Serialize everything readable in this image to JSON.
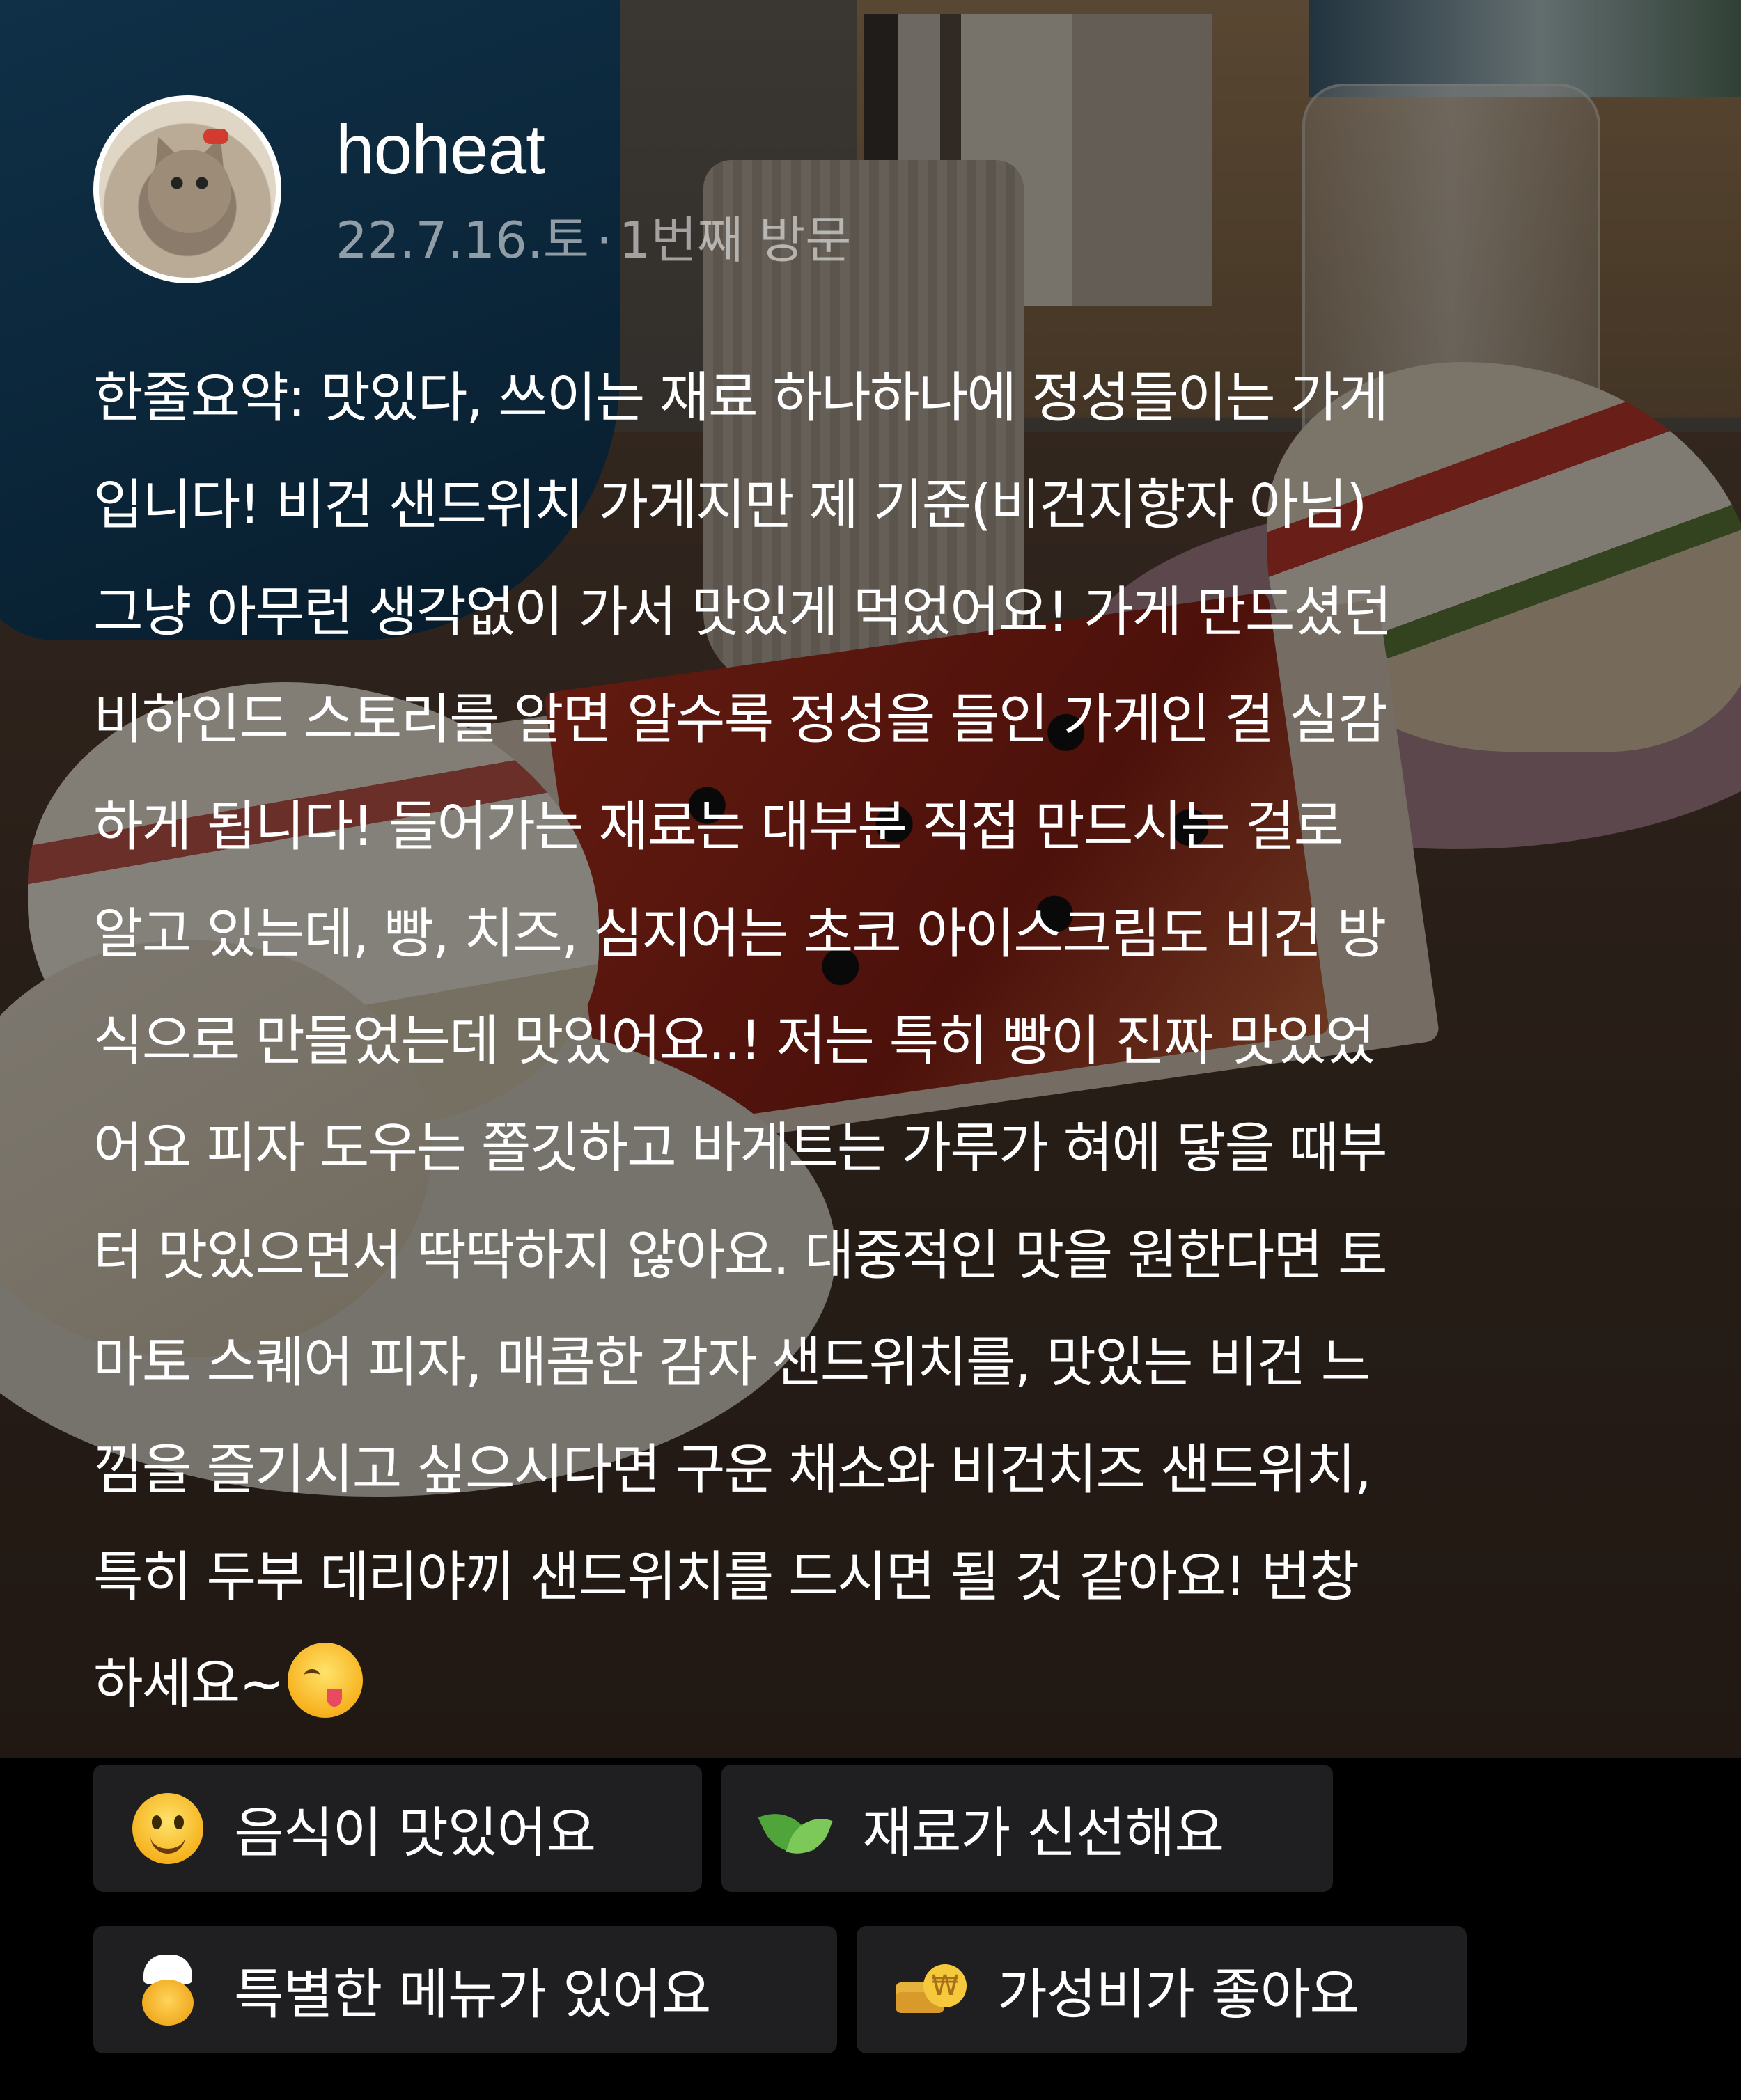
{
  "review": {
    "username": "hoheat",
    "date": "22.7.16.토",
    "separator": "·",
    "visit": "1번째 방문",
    "body_lines": [
      "한줄요약: 맛있다, 쓰이는 재료 하나하나에 정성들이는 가게",
      "입니다! 비건 샌드위치 가게지만 제 기준(비건지향자 아님)",
      "그냥 아무런 생각없이 가서 맛있게 먹었어요! 가게 만드셨던",
      "비하인드 스토리를 알면 알수록 정성을 들인 가게인 걸 실감",
      "하게 됩니다! 들어가는 재료는 대부분 직접 만드시는 걸로",
      "알고 있는데, 빵, 치즈, 심지어는 초코 아이스크림도 비건 방",
      "식으로 만들었는데 맛있어요..! 저는 특히 빵이 진짜 맛있었",
      "어요 피자 도우는 쫄깃하고 바게트는 가루가 혀에 닿을 때부",
      "터 맛있으면서 딱딱하지 않아요. 대중적인 맛을 원한다면 토",
      "마토 스퀘어 피자, 매콤한 감자 샌드위치를, 맛있는 비건 느",
      "낌을 즐기시고 싶으시다면 구운 채소와 비건치즈 샌드위치,",
      "특히 두부 데리야끼 샌드위치를 드시면 될 것 같아요! 번창",
      "하세요~"
    ],
    "end_emoji": "yum-face-emoji"
  },
  "keywords": [
    {
      "label": "음식이 맛있어요",
      "icon": "smiling-face-icon"
    },
    {
      "label": "재료가 신선해요",
      "icon": "leaf-icon"
    },
    {
      "label": "특별한 메뉴가 있어요",
      "icon": "chef-icon"
    },
    {
      "label": "가성비가 좋아요",
      "icon": "coin-icon"
    }
  ],
  "colors": {
    "text": "#ffffff",
    "meta_text": "#b3b3b3",
    "chip_background": "#1f1f22",
    "page_background": "#000000"
  }
}
